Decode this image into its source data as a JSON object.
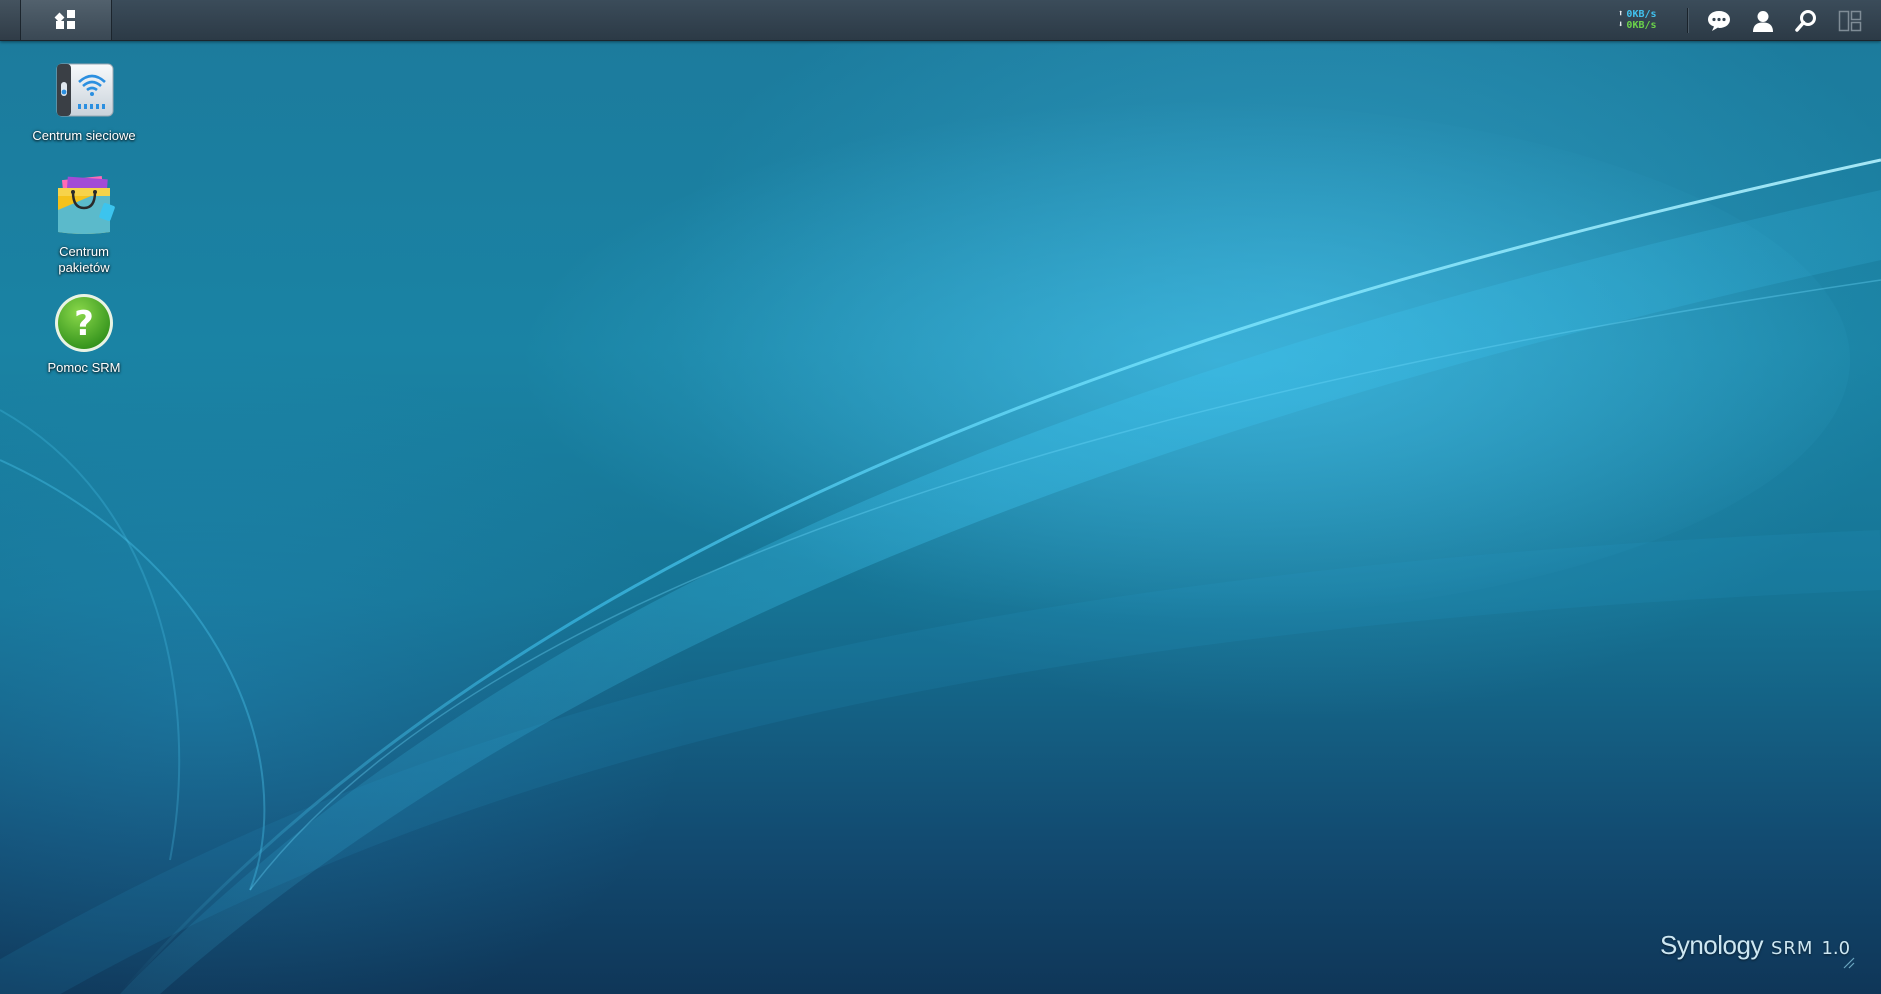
{
  "taskbar": {
    "traffic": {
      "upload": "0KB/s",
      "download": "0KB/s",
      "upload_color": "#41c2ef",
      "download_color": "#6bd34a"
    },
    "icons": [
      "main-menu-icon",
      "notifications-icon",
      "user-icon",
      "search-icon",
      "widgets-icon"
    ]
  },
  "desktop": {
    "shortcuts": [
      {
        "label": "Centrum sieciowe",
        "icon": "network-center-icon"
      },
      {
        "label": "Centrum\npakietów",
        "line1": "Centrum",
        "line2": "pakietów",
        "icon": "package-center-icon"
      },
      {
        "label": "Pomoc SRM",
        "icon": "help-icon"
      }
    ]
  },
  "brand": {
    "name": "Synology",
    "product": "SRM",
    "version": "1.0"
  },
  "colors": {
    "wallpaper_accent": "#1fb4e6",
    "taskbar": "#34434f"
  }
}
